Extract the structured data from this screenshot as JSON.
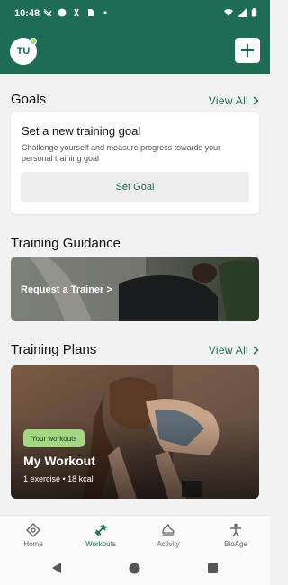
{
  "status_bar": {
    "time": "10:48"
  },
  "header": {
    "avatar_initials": "TU"
  },
  "goals": {
    "title": "Goals",
    "view_all": "View All",
    "card_title": "Set a new training goal",
    "card_desc": "Challenge yourself and measure progress towards your personal training goal",
    "button": "Set Goal"
  },
  "guidance": {
    "title": "Training Guidance",
    "card_label": "Request a Trainer >"
  },
  "plans": {
    "title": "Training Plans",
    "view_all": "View All",
    "chip": "Your workouts",
    "card_title": "My Workout",
    "card_meta": "1 exercise • 18 kcal"
  },
  "bottom_nav": {
    "items": [
      {
        "label": "Home",
        "icon": "home-target-icon"
      },
      {
        "label": "Workouts",
        "icon": "dumbbell-icon"
      },
      {
        "label": "Activity",
        "icon": "shoe-icon"
      },
      {
        "label": "BioAge",
        "icon": "person-icon"
      }
    ],
    "active_index": 1
  },
  "colors": {
    "brand": "#1e6b56",
    "chip": "#a5d783",
    "background": "#f2f2f2"
  }
}
